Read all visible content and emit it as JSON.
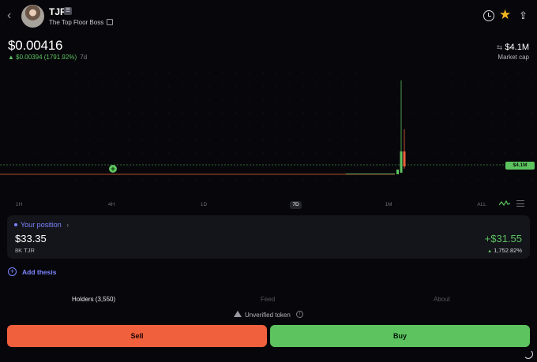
{
  "header": {
    "ticker": "TJR",
    "ticker_badge": "☰",
    "token_name": "The Top Floor Boss",
    "back_glyph": "‹",
    "star_glyph": "★",
    "share_glyph": "⇪"
  },
  "price": {
    "current": "$0.00416",
    "change_arrow": "▲",
    "change": "$0.00394 (1791.92%)",
    "period": "7d"
  },
  "market_cap": {
    "swap_glyph": "⇆",
    "value": "$4.1M",
    "label": "Market cap"
  },
  "chart": {
    "tag": "$4.1M",
    "marker": "+",
    "timeframes": [
      "1H",
      "4H",
      "1D",
      "7D",
      "1M",
      "ALL"
    ],
    "active_timeframe": "7D",
    "accent_up": "#5cc35f",
    "accent_down": "#f0603c"
  },
  "position": {
    "title": "Your position",
    "chevron": "›",
    "value": "$33.35",
    "quantity": "8K TJR",
    "pnl": "+$31.55",
    "pnl_arrow": "▲",
    "pnl_percent": "1,752.82%"
  },
  "thesis": {
    "icon": "+",
    "label": "Add thesis"
  },
  "tabs": [
    {
      "label": "Holders (3,550)",
      "active": true
    },
    {
      "label": "Feed",
      "active": false
    },
    {
      "label": "About",
      "active": false
    }
  ],
  "notice": {
    "text": "Unverified token",
    "info": "i"
  },
  "actions": {
    "sell": "Sell",
    "buy": "Buy"
  }
}
